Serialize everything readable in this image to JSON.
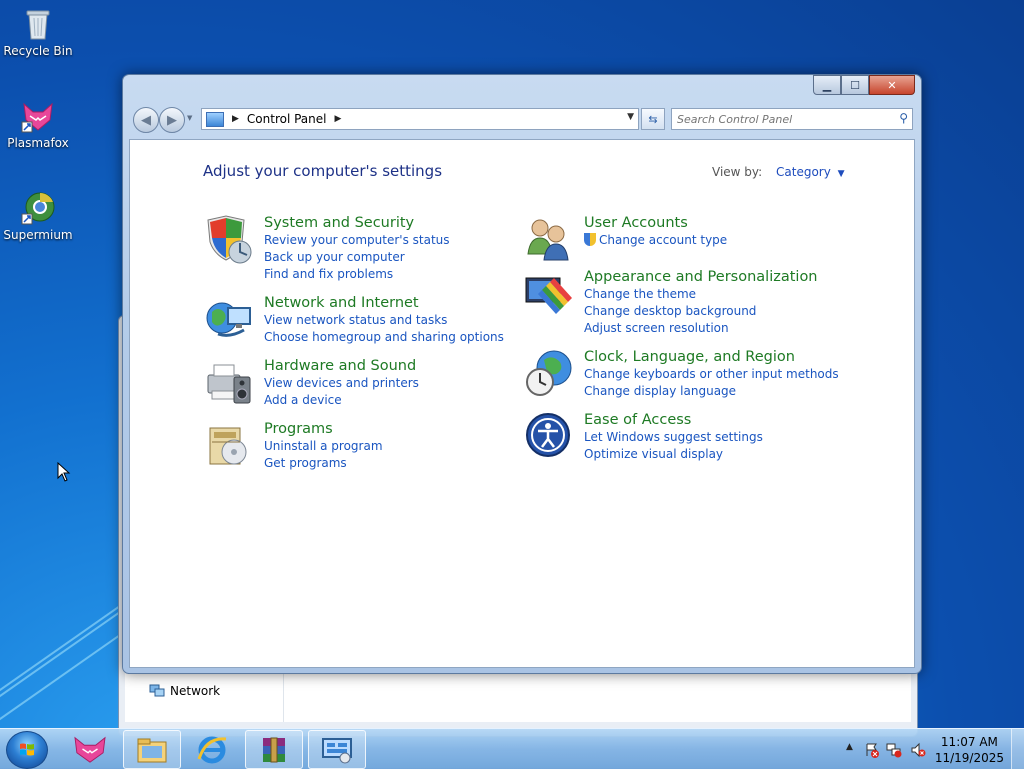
{
  "desktop": {
    "icons": [
      {
        "label": "Recycle Bin"
      },
      {
        "label": "Plasmafox"
      },
      {
        "label": "Supermium"
      }
    ]
  },
  "background_window": {
    "nav_item": "Network"
  },
  "window": {
    "address": {
      "crumb": "Control Panel"
    },
    "search": {
      "placeholder": "Search Control Panel"
    },
    "heading": "Adjust your computer's settings",
    "view_by": {
      "label": "View by:",
      "value": "Category"
    },
    "categories_left": [
      {
        "title": "System and Security",
        "links": [
          "Review your computer's status",
          "Back up your computer",
          "Find and fix problems"
        ]
      },
      {
        "title": "Network and Internet",
        "links": [
          "View network status and tasks",
          "Choose homegroup and sharing options"
        ]
      },
      {
        "title": "Hardware and Sound",
        "links": [
          "View devices and printers",
          "Add a device"
        ]
      },
      {
        "title": "Programs",
        "links": [
          "Uninstall a program",
          "Get programs"
        ]
      }
    ],
    "categories_right": [
      {
        "title": "User Accounts",
        "links": [
          "Change account type"
        ]
      },
      {
        "title": "Appearance and Personalization",
        "links": [
          "Change the theme",
          "Change desktop background",
          "Adjust screen resolution"
        ]
      },
      {
        "title": "Clock, Language, and Region",
        "links": [
          "Change keyboards or other input methods",
          "Change display language"
        ]
      },
      {
        "title": "Ease of Access",
        "links": [
          "Let Windows suggest settings",
          "Optimize visual display"
        ]
      }
    ]
  },
  "taskbar": {
    "clock": {
      "time": "11:07 AM",
      "date": "11/19/2025"
    }
  },
  "colors": {
    "category_title": "#1e7a24",
    "link": "#1a55c0",
    "heading": "#1e3287"
  }
}
